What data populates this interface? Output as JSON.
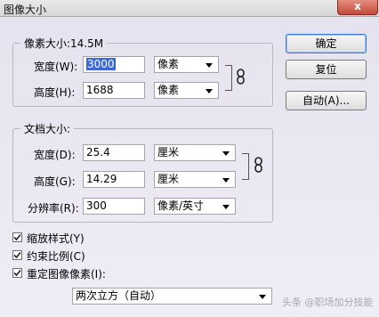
{
  "window": {
    "title": "图像大小",
    "close_label": "x"
  },
  "pixel_dimensions": {
    "legend": "像素大小:14.5M",
    "width": {
      "label": "宽度(W):",
      "value": "3000",
      "unit": "像素"
    },
    "height": {
      "label": "高度(H):",
      "value": "1688",
      "unit": "像素"
    }
  },
  "document_size": {
    "legend": "文档大小:",
    "width": {
      "label": "宽度(D):",
      "value": "25.4",
      "unit": "厘米"
    },
    "height": {
      "label": "高度(G):",
      "value": "14.29",
      "unit": "厘米"
    },
    "resolution": {
      "label": "分辨率(R):",
      "value": "300",
      "unit": "像素/英寸"
    }
  },
  "buttons": {
    "ok": "确定",
    "reset": "复位",
    "auto": "自动(A)..."
  },
  "options": {
    "scale_styles": {
      "label": "缩放样式(Y)",
      "checked": true
    },
    "constrain_proportions": {
      "label": "约束比例(C)",
      "checked": true
    },
    "resample": {
      "label": "重定图像像素(I):",
      "checked": true
    },
    "resample_method": "两次立方（自动）"
  },
  "watermark": "头条 @职场加分技能"
}
